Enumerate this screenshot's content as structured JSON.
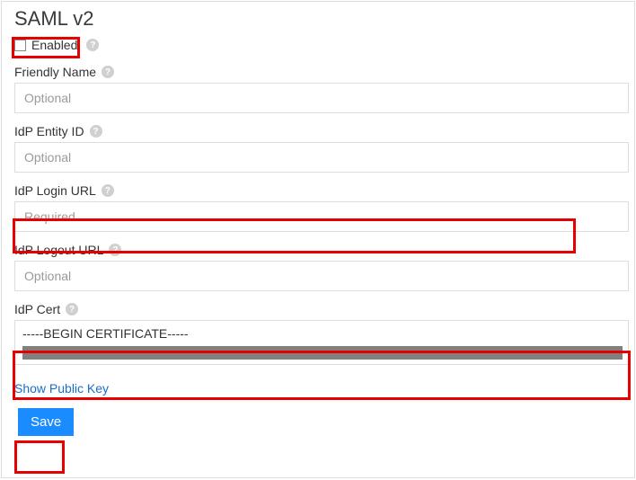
{
  "title": "SAML v2",
  "enabled": {
    "label": "Enabled",
    "checked": false
  },
  "fields": {
    "friendly_name": {
      "label": "Friendly Name",
      "placeholder": "Optional",
      "value": ""
    },
    "entity_id": {
      "label": "IdP Entity ID",
      "placeholder": "Optional",
      "value": ""
    },
    "login_url": {
      "label": "IdP Login URL",
      "placeholder": "Required",
      "value": ""
    },
    "logout_url": {
      "label": "IdP Logout URL",
      "placeholder": "Optional",
      "value": ""
    },
    "cert": {
      "label": "IdP Cert",
      "line1": "-----BEGIN CERTIFICATE-----"
    }
  },
  "link": "Show Public Key",
  "save_label": "Save",
  "help_glyph": "?"
}
